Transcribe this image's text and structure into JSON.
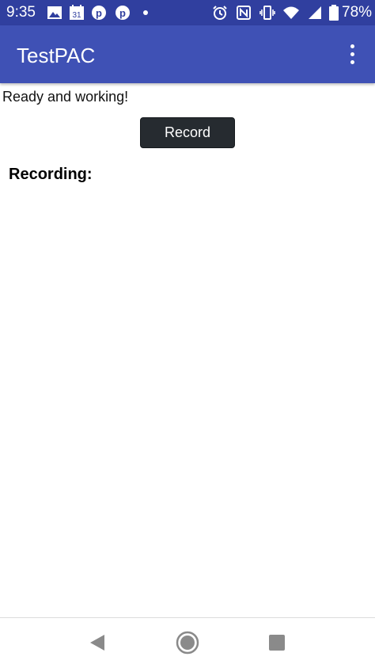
{
  "status_bar": {
    "time": "9:35",
    "calendar_day": "31",
    "battery": "78%",
    "icons": [
      "image-icon",
      "calendar-icon",
      "pinterest-icon",
      "pinterest-icon",
      "notification-dot-icon",
      "alarm-icon",
      "nfc-icon",
      "vibrate-icon",
      "wifi-icon",
      "signal-icon",
      "battery-icon"
    ]
  },
  "app_bar": {
    "title": "TestPAC",
    "menu_icon": "more-vert-icon"
  },
  "main": {
    "status_text": "Ready and working!",
    "record_label": "Record",
    "recording_heading": "Recording:"
  },
  "nav_bar": {
    "icons": [
      "back-icon",
      "home-icon",
      "recents-icon"
    ]
  },
  "colors": {
    "status_bar": "#303f9f",
    "app_bar": "#3f51b5",
    "button": "#262b30"
  }
}
